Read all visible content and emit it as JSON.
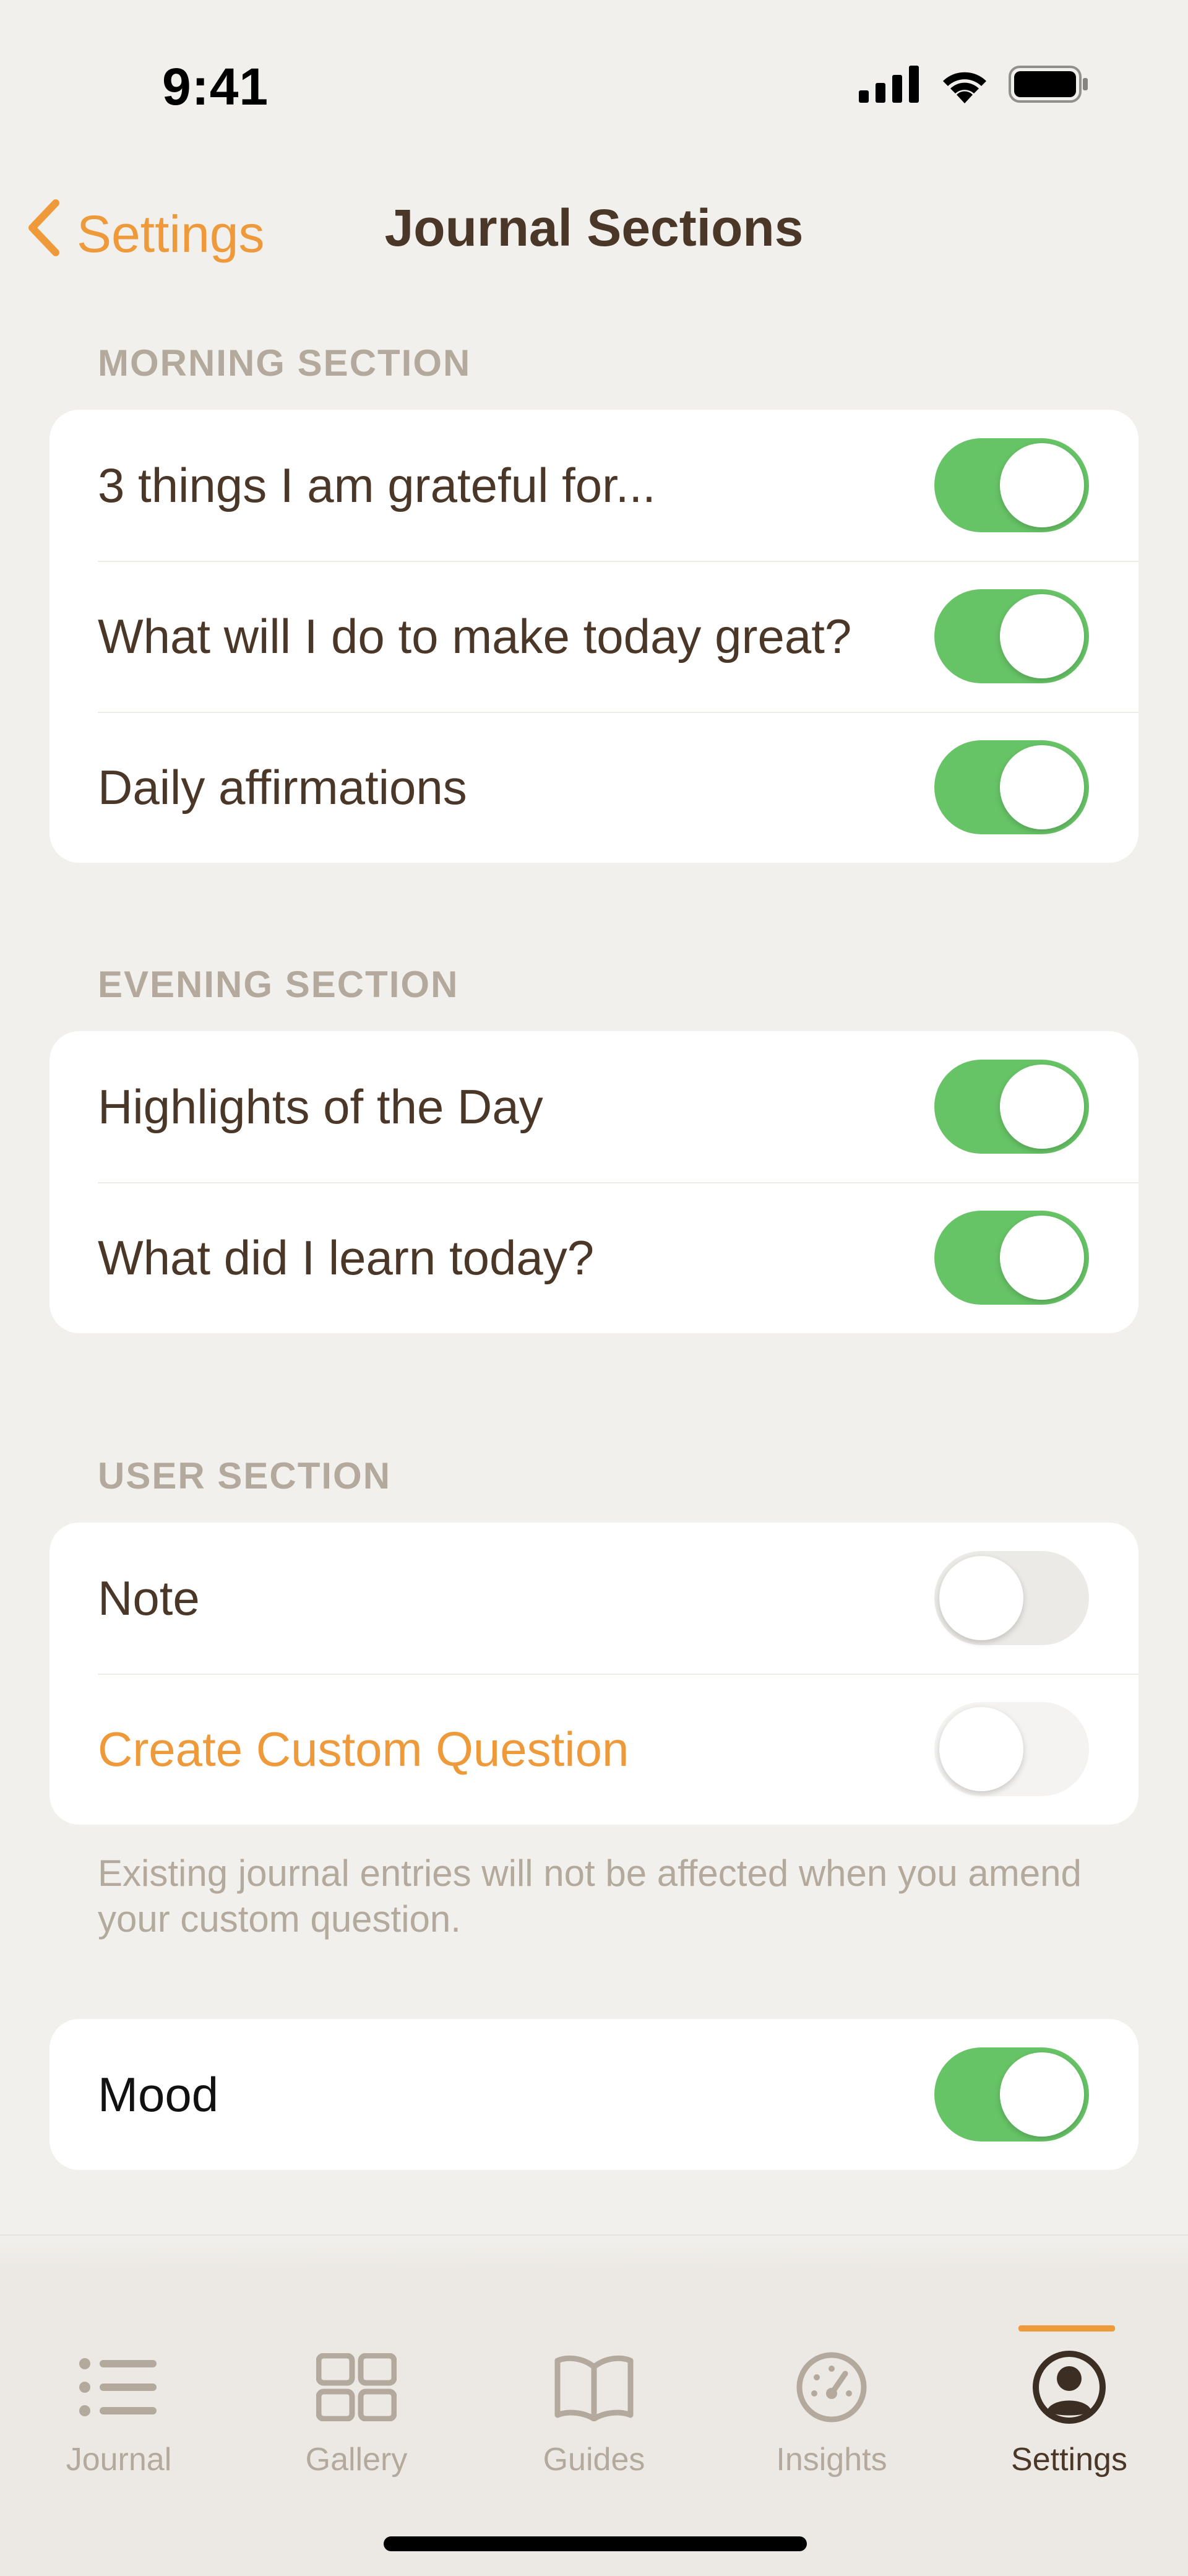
{
  "status_bar": {
    "time": "9:41"
  },
  "nav": {
    "back_label": "Settings",
    "title": "Journal Sections"
  },
  "sections": {
    "morning": {
      "header": "MORNING SECTION",
      "rows": [
        {
          "label": "3 things I am grateful for...",
          "on": true
        },
        {
          "label": "What will I do to make today great?",
          "on": true
        },
        {
          "label": "Daily affirmations",
          "on": true
        }
      ]
    },
    "evening": {
      "header": "EVENING SECTION",
      "rows": [
        {
          "label": "Highlights of the Day",
          "on": true
        },
        {
          "label": "What did I learn today?",
          "on": true
        }
      ]
    },
    "user": {
      "header": "USER SECTION",
      "rows": [
        {
          "label": "Note",
          "on": false
        },
        {
          "label": "Create Custom Question",
          "on": false
        }
      ],
      "footnote": "Existing journal entries will not be affected when you amend your custom question."
    },
    "mood": {
      "rows": [
        {
          "label": "Mood",
          "on": true
        }
      ]
    }
  },
  "tabs": [
    {
      "label": "Journal",
      "icon": "list-icon",
      "active": false
    },
    {
      "label": "Gallery",
      "icon": "grid-icon",
      "active": false
    },
    {
      "label": "Guides",
      "icon": "book-icon",
      "active": false
    },
    {
      "label": "Insights",
      "icon": "gauge-icon",
      "active": false
    },
    {
      "label": "Settings",
      "icon": "profile-icon",
      "active": true
    }
  ],
  "colors": {
    "accent": "#EE9A3A",
    "toggle_on": "#67C466",
    "background": "#F2F0EC",
    "text": "#4A3728",
    "muted": "#B3A99C"
  }
}
